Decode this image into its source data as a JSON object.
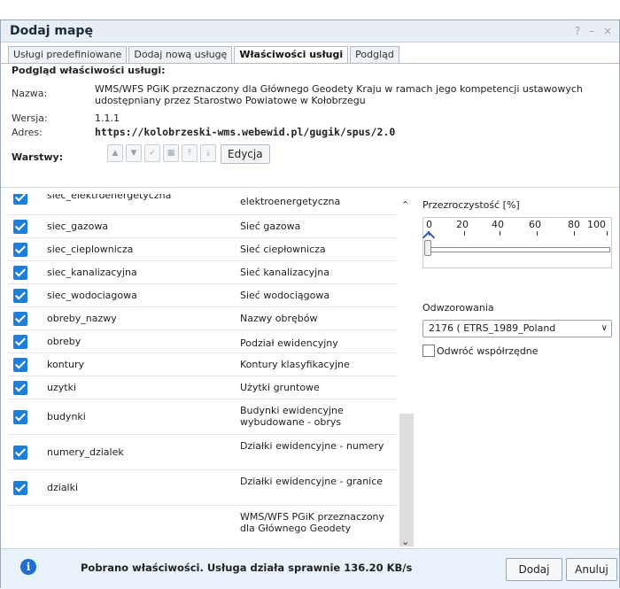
{
  "window": {
    "title": "Dodaj mapę",
    "controls": [
      "?",
      "–",
      "×"
    ]
  },
  "tabs": [
    "Usługi predefiniowane",
    "Dodaj nową usługę",
    "Właściwości usługi",
    "Podgląd"
  ],
  "active_tab": 2,
  "props": {
    "heading": "Podgląd właściwości usługi:",
    "name_label": "Nazwa:",
    "name_value": "WMS/WFS PGiK przeznaczony dla Głównego Geodety Kraju w ramach jego kompetencji ustawowych udostępniany przez Starostwo Powiatowe w Kołobrzegu",
    "version_label": "Wersja:",
    "version_value": "1.1.1",
    "address_label": "Adres:",
    "address_value": "https://kolobrzeski-wms.webewid.pl/gugik/spus/2.0",
    "layers_label": "Warstwy:",
    "edit_label": "Edycja"
  },
  "layers": [
    {
      "name": "siec_elektroenergetyczna",
      "desc": "elektroenergetyczna",
      "checked": true
    },
    {
      "name": "siec_gazowa",
      "desc": "Sieć gazowa",
      "checked": true
    },
    {
      "name": "siec_cieplownicza",
      "desc": "Sieć ciepłownicza",
      "checked": true
    },
    {
      "name": "siec_kanalizacyjna",
      "desc": "Sieć kanalizacyjna",
      "checked": true
    },
    {
      "name": "siec_wodociagowa",
      "desc": "Sieć wodociągowa",
      "checked": true
    },
    {
      "name": "obreby_nazwy",
      "desc": "Nazwy obrębów",
      "checked": true
    },
    {
      "name": "obreby",
      "desc": "Podział ewidencyjny",
      "checked": true
    },
    {
      "name": "kontury",
      "desc": "Kontury klasyfikacyjne",
      "checked": true
    },
    {
      "name": "uzytki",
      "desc": "Użytki gruntowe",
      "checked": true
    },
    {
      "name": "budynki",
      "desc": "Budynki ewidencyjne wybudowane - obrys",
      "checked": true
    },
    {
      "name": "numery_dzialek",
      "desc": "Działki ewidencyjne - numery",
      "checked": true
    },
    {
      "name": "dzialki",
      "desc": "Działki ewidencyjne - granice",
      "checked": true
    },
    {
      "name": "",
      "desc": "WMS/WFS PGiK przeznaczony dla Głównego Geodety",
      "checked": false
    }
  ],
  "opacity": {
    "label": "Przezroczystość [%]",
    "ticks": [
      "0",
      "20",
      "40",
      "60",
      "80",
      "100"
    ],
    "value": 0
  },
  "projection": {
    "label": "Odwzorowania",
    "selected": "2176 ( ETRS_1989_Poland"
  },
  "flip_label": "Odwróć współrzędne",
  "status": {
    "text": "Pobrano właściwości. Usługa działa sprawnie 136.20 KB/s"
  },
  "buttons": {
    "add": "Dodaj",
    "cancel": "Anuluj"
  },
  "colors": {
    "accent": "#1f7fd8",
    "status_bg": "#eaf3fb",
    "title_bg": "#e9eef4"
  }
}
